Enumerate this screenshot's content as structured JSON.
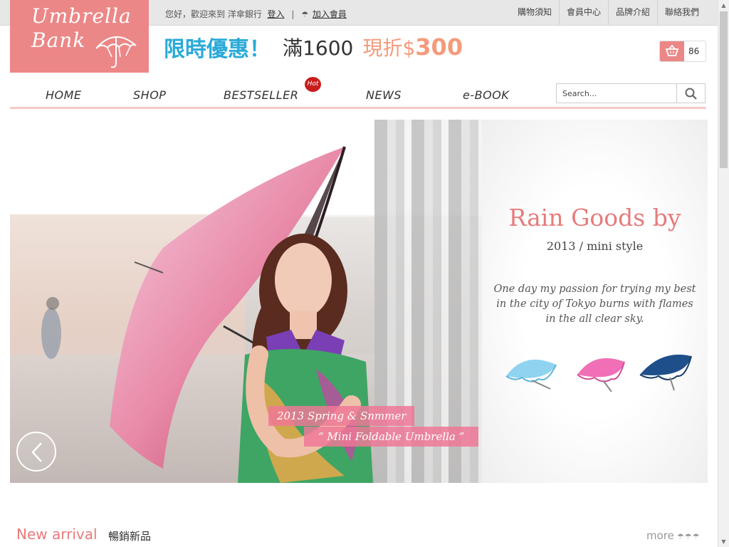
{
  "topbar": {
    "greeting": "您好，歡迎來到 洋傘銀行",
    "login": "登入",
    "separator": "|",
    "join_icon": "umbrella-icon",
    "join": "加入會員",
    "links": [
      "購物須知",
      "會員中心",
      "品牌介紹",
      "聯絡我們"
    ]
  },
  "logo": {
    "line1": "Umbrella",
    "line2": "Bank"
  },
  "promo": {
    "part1": "限時優惠！",
    "part2": "滿1600",
    "part3": "現折$",
    "part4": "300"
  },
  "cart": {
    "icon": "basket-icon",
    "count": "86"
  },
  "nav": {
    "items": [
      "HOME",
      "SHOP",
      "BESTSELLER",
      "NEWS",
      "e-BOOK"
    ],
    "hot_badge": "Hot"
  },
  "search": {
    "placeholder": "Search...",
    "icon": "search-icon"
  },
  "banner": {
    "caption1": "2013 Spring & Snmmer",
    "caption2": "“ Mini Foldable Umbrella ”",
    "title": "Rain Goods by",
    "subtitle": "2013 / mini style",
    "tagline": "One day my passion for trying my best in the city of Tokyo burns with flames in the all clear sky.",
    "umbrella_colors": [
      "#8fd3f0",
      "#f06fb6",
      "#1f4f8a"
    ]
  },
  "new_arrival": {
    "title": "New arrival",
    "subtitle": "暢銷新品",
    "more": "more",
    "more_arrows": "☂☂☂"
  },
  "colors": {
    "accent": "#ec8787",
    "promo_blue": "#2aaad8",
    "promo_orange": "#f39b7c",
    "hot": "#c81d1d"
  }
}
